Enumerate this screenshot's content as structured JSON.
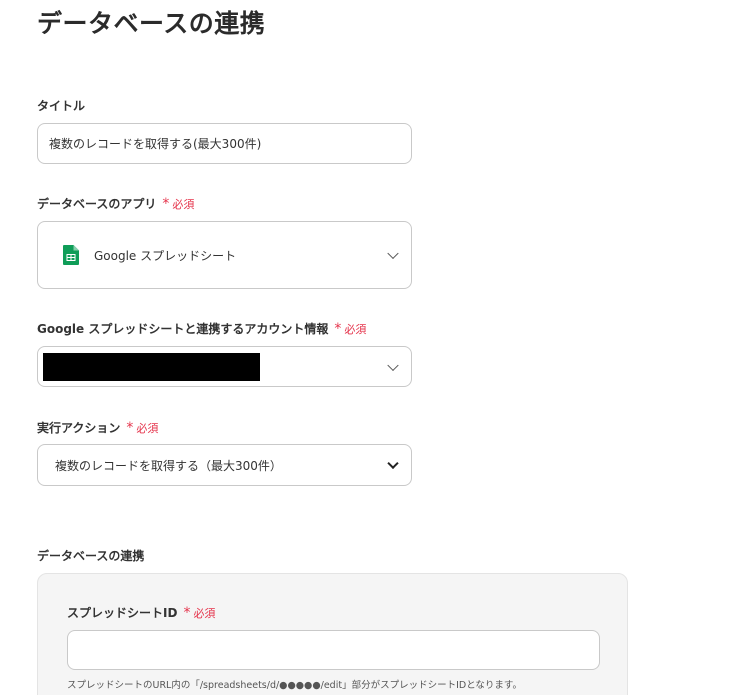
{
  "header": {
    "title": "データベースの連携"
  },
  "fields": {
    "title": {
      "label": "タイトル",
      "value": "複数のレコードを取得する(最大300件)"
    },
    "app": {
      "label": "データベースのアプリ",
      "required": "必須",
      "value": "Google スプレッドシート",
      "icon": "google-sheets-icon"
    },
    "account": {
      "label": "Google スプレッドシートと連携するアカウント情報",
      "required": "必須",
      "value": ""
    },
    "action": {
      "label": "実行アクション",
      "required": "必須",
      "value": "複数のレコードを取得する（最大300件）"
    }
  },
  "section": {
    "title": "データベースの連携",
    "spreadsheet_id": {
      "label": "スプレッドシートID",
      "required": "必須",
      "value": "",
      "hint": "スプレッドシートのURL内の「/spreadsheets/d/●●●●●/edit」部分がスプレッドシートIDとなります。"
    }
  },
  "colors": {
    "required": "#e5334b",
    "sheets_green": "#0f9d58",
    "panel_bg": "#f5f5f5"
  }
}
